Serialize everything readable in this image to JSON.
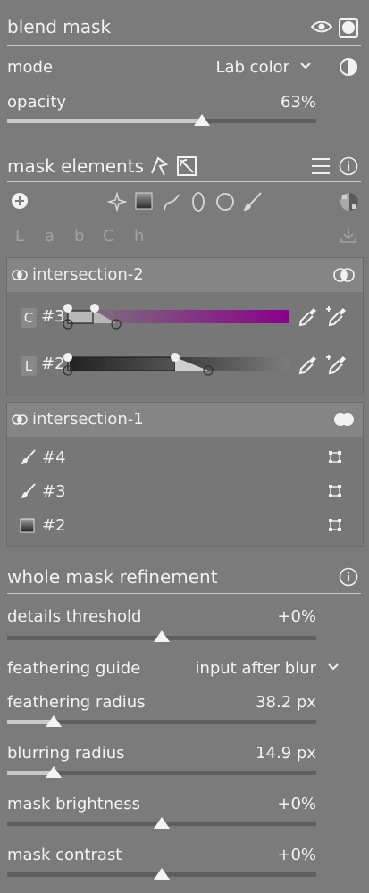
{
  "header": {
    "title": "blend mask"
  },
  "mode": {
    "label": "mode",
    "value": "Lab color"
  },
  "opacity": {
    "label": "opacity",
    "value": "63%",
    "level": 0.63
  },
  "mask_elements": {
    "title": "mask elements",
    "channels": [
      "L",
      "a",
      "b",
      "C",
      "h"
    ]
  },
  "groups": [
    {
      "name": "intersection-2",
      "rows": [
        {
          "channel": "C",
          "label": "#3"
        },
        {
          "channel": "L",
          "label": "#2"
        }
      ]
    },
    {
      "name": "intersection-1",
      "items": [
        {
          "icon": "brush-icon",
          "label": "#4"
        },
        {
          "icon": "brush-icon",
          "label": "#3"
        },
        {
          "icon": "gradient-icon",
          "label": "#2"
        }
      ]
    }
  ],
  "refinement": {
    "title": "whole mask refinement",
    "details_threshold": {
      "label": "details threshold",
      "value": "+0%",
      "level": 0.5
    },
    "feathering_guide": {
      "label": "feathering guide",
      "value": "input after blur"
    },
    "feathering_radius": {
      "label": "feathering radius",
      "value": "38.2 px",
      "level": 0.15
    },
    "blurring_radius": {
      "label": "blurring radius",
      "value": "14.9 px",
      "level": 0.15
    },
    "mask_brightness": {
      "label": "mask brightness",
      "value": "+0%",
      "level": 0.5
    },
    "mask_contrast": {
      "label": "mask contrast",
      "value": "+0%",
      "level": 0.5
    }
  },
  "colors": {
    "background": "#7b7b7b",
    "chroma_gradient_end": "#8a008a",
    "text": "#f4f4f4"
  }
}
